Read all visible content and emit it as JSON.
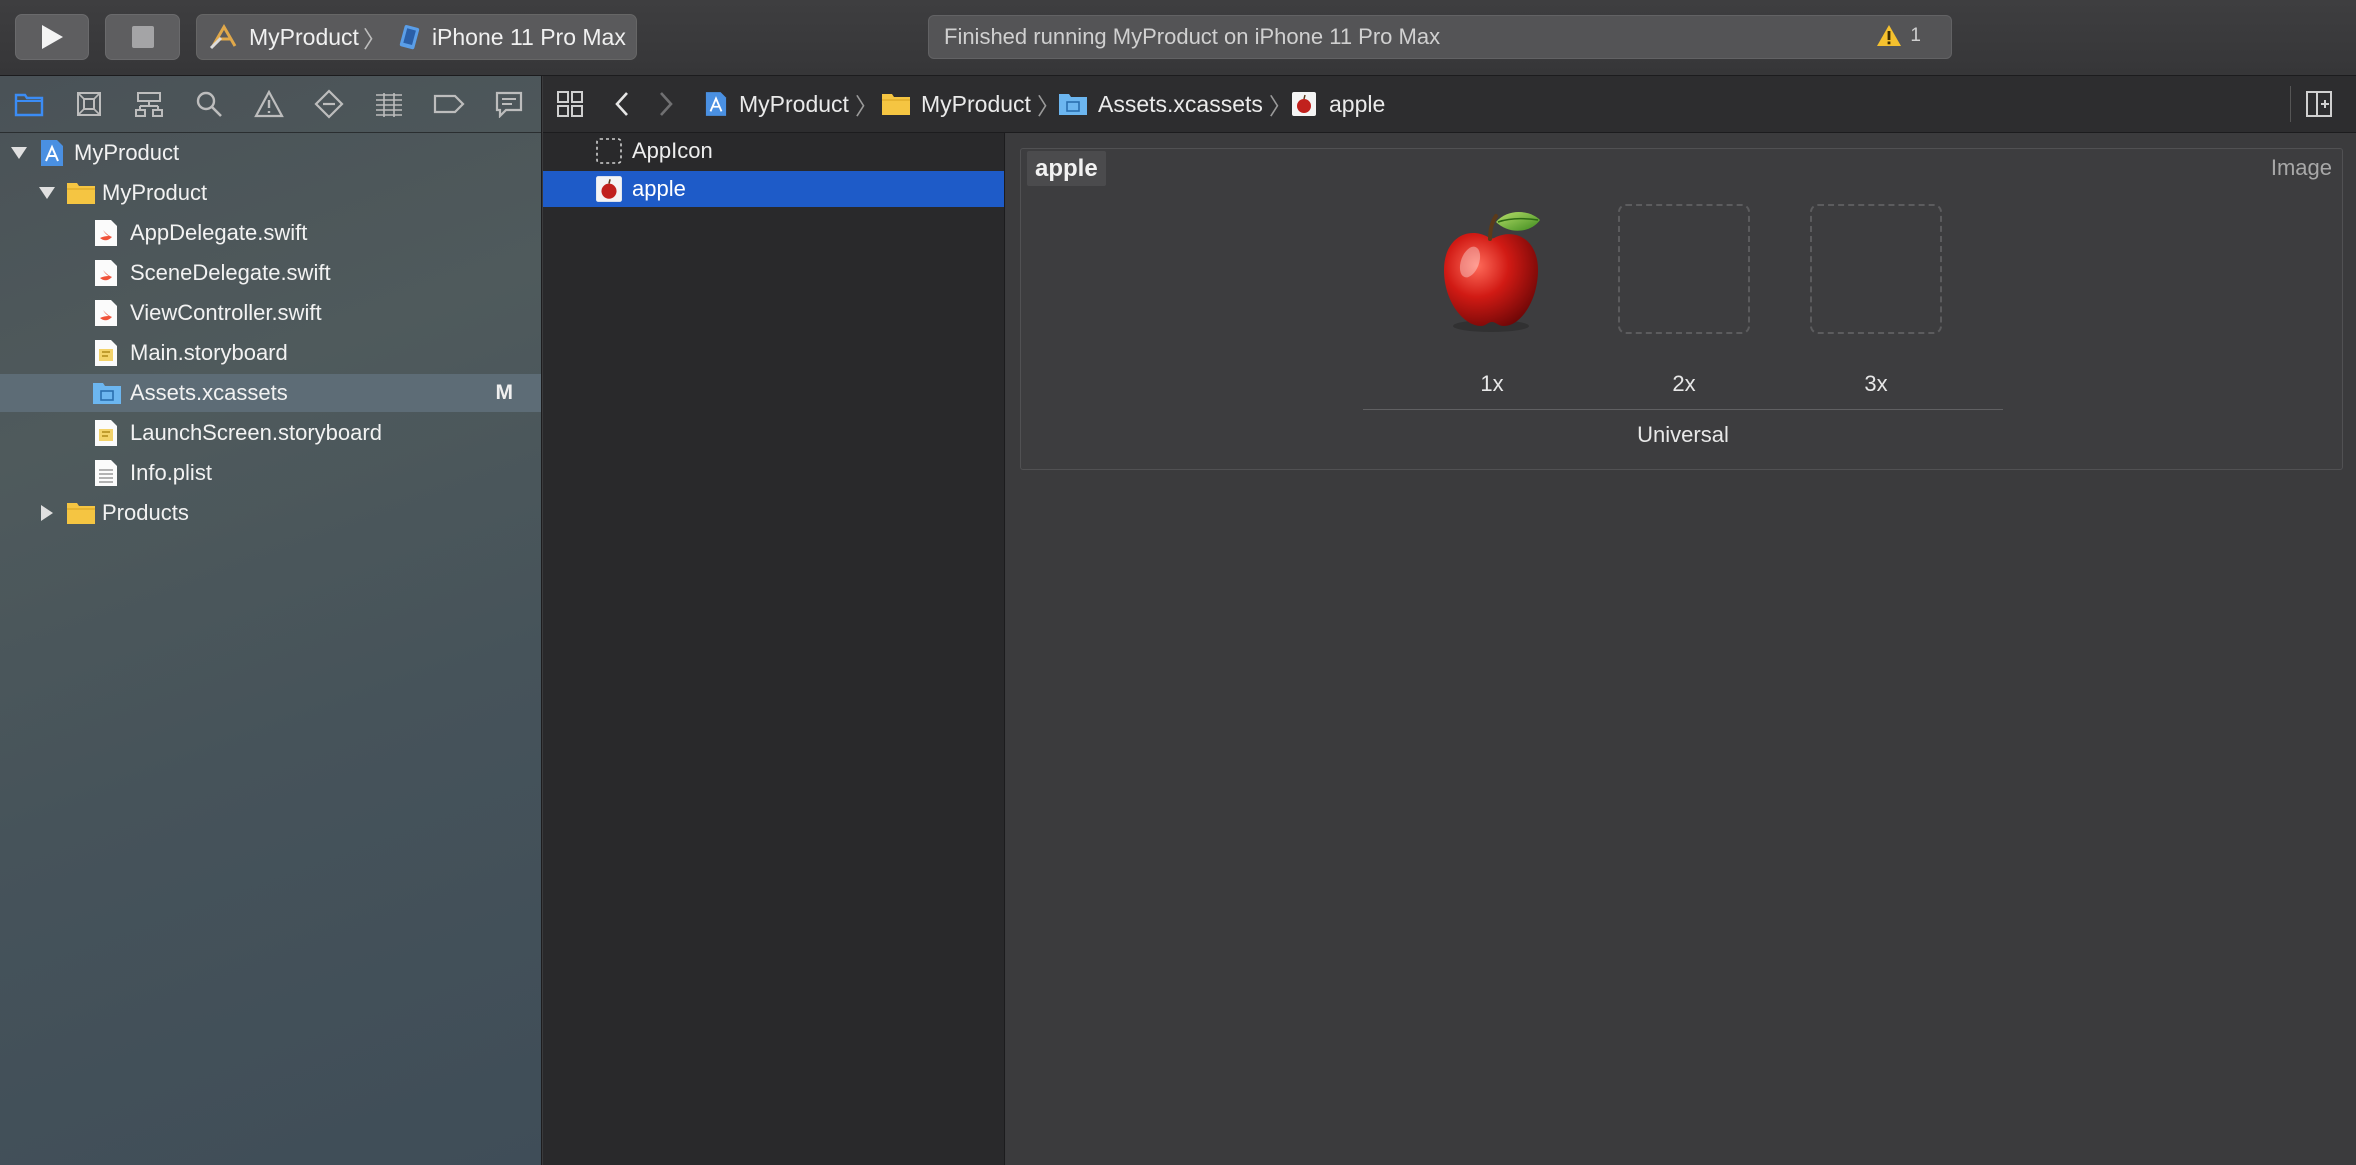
{
  "toolbar": {
    "run_icon": "play-icon",
    "stop_icon": "stop-icon",
    "scheme": {
      "project": "MyProduct",
      "separator": "〉",
      "device": "iPhone 11 Pro Max"
    },
    "status": {
      "text": "Finished running MyProduct on iPhone 11 Pro Max",
      "warning_count": "1"
    }
  },
  "navigator": {
    "tabs": [
      "project-navigator-icon",
      "source-control-icon",
      "symbol-navigator-icon",
      "find-navigator-icon",
      "issue-navigator-icon",
      "test-navigator-icon",
      "debug-navigator-icon",
      "breakpoint-navigator-icon",
      "report-navigator-icon"
    ],
    "tree": [
      {
        "label": "MyProduct",
        "kind": "project"
      },
      {
        "label": "MyProduct",
        "kind": "folder"
      },
      {
        "label": "AppDelegate.swift",
        "kind": "swift"
      },
      {
        "label": "SceneDelegate.swift",
        "kind": "swift"
      },
      {
        "label": "ViewController.swift",
        "kind": "swift"
      },
      {
        "label": "Main.storyboard",
        "kind": "storyboard"
      },
      {
        "label": "Assets.xcassets",
        "kind": "assets",
        "badge": "M"
      },
      {
        "label": "LaunchScreen.storyboard",
        "kind": "storyboard"
      },
      {
        "label": "Info.plist",
        "kind": "plist"
      },
      {
        "label": "Products",
        "kind": "folder"
      }
    ]
  },
  "jumpbar": {
    "path": [
      "MyProduct",
      "MyProduct",
      "Assets.xcassets",
      "apple"
    ]
  },
  "asset_list": {
    "items": [
      {
        "label": "AppIcon"
      },
      {
        "label": "apple"
      }
    ]
  },
  "asset_detail": {
    "set_name": "apple",
    "set_type": "Image",
    "slots": [
      "1x",
      "2x",
      "3x"
    ],
    "device": "Universal"
  },
  "colors": {
    "selection": "#1e5bc8",
    "folder": "#f5c542",
    "swift": "#f05138"
  }
}
